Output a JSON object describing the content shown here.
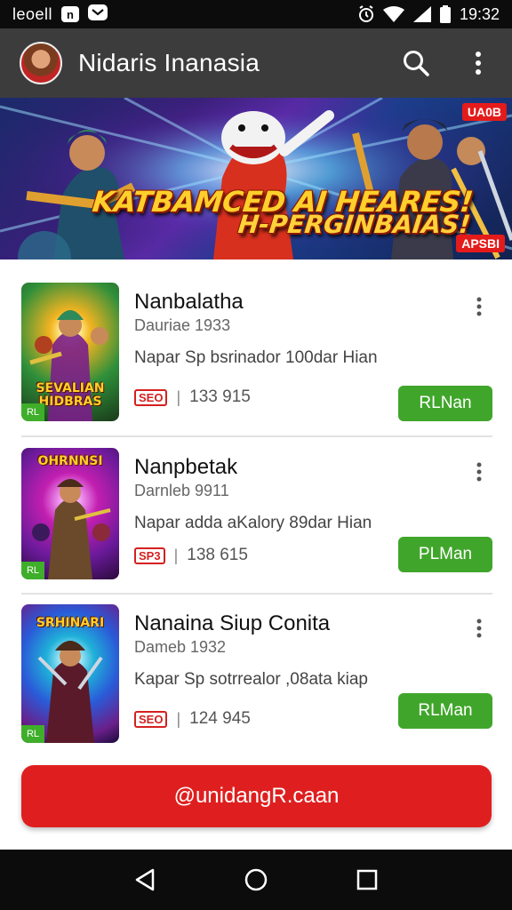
{
  "status_bar": {
    "carrier": "leoell",
    "icon_a": "n",
    "time": "19:32"
  },
  "app_bar": {
    "title": "Nidaris Inanasia"
  },
  "banner": {
    "headline_line1": "KATBAMCED AI HEARES!",
    "headline_line2": "H-PERGINBAIAS!",
    "badge_top": "UA0B",
    "badge_bottom": "APSBI"
  },
  "games": [
    {
      "name": "Nanbalatha",
      "subtitle": "Dauriae 1933",
      "description": "Napar Sp bsrinador 100dar Hian",
      "rating": "SEO",
      "downloads": "133 915",
      "button": "RLNan",
      "thumb_title": "SEVALIAN HIDBRAS",
      "thumb_badge": "RL",
      "colors": [
        "#f2b321",
        "#2f8f3a",
        "#7a1f8a"
      ]
    },
    {
      "name": "Nanpbetak",
      "subtitle": "Darnleb 9911",
      "description": "Napar adda aKalory 89dar Hian",
      "rating": "SP3",
      "downloads": "138 615",
      "button": "PLMan",
      "thumb_title": "OHRNNSI",
      "thumb_badge": "RL",
      "colors": [
        "#c21fb0",
        "#6a1a9a",
        "#f06ad8"
      ]
    },
    {
      "name": "Nanaina Siup Conita",
      "subtitle": "Dameb 1932",
      "description": "Kapar Sp sotrrealor ,08ata kiap",
      "rating": "SEO",
      "downloads": "124 945",
      "button": "RLMan",
      "thumb_title": "SRHINARI",
      "thumb_badge": "RL",
      "colors": [
        "#2a5bd8",
        "#6a1f8a",
        "#1fb0d8"
      ]
    }
  ],
  "cta": {
    "label": "@unidangR.caan"
  },
  "icons": {
    "search": "search-icon",
    "more": "more-vert-icon",
    "back": "back-triangle-icon",
    "home": "home-circle-icon",
    "recents": "recents-square-icon"
  }
}
